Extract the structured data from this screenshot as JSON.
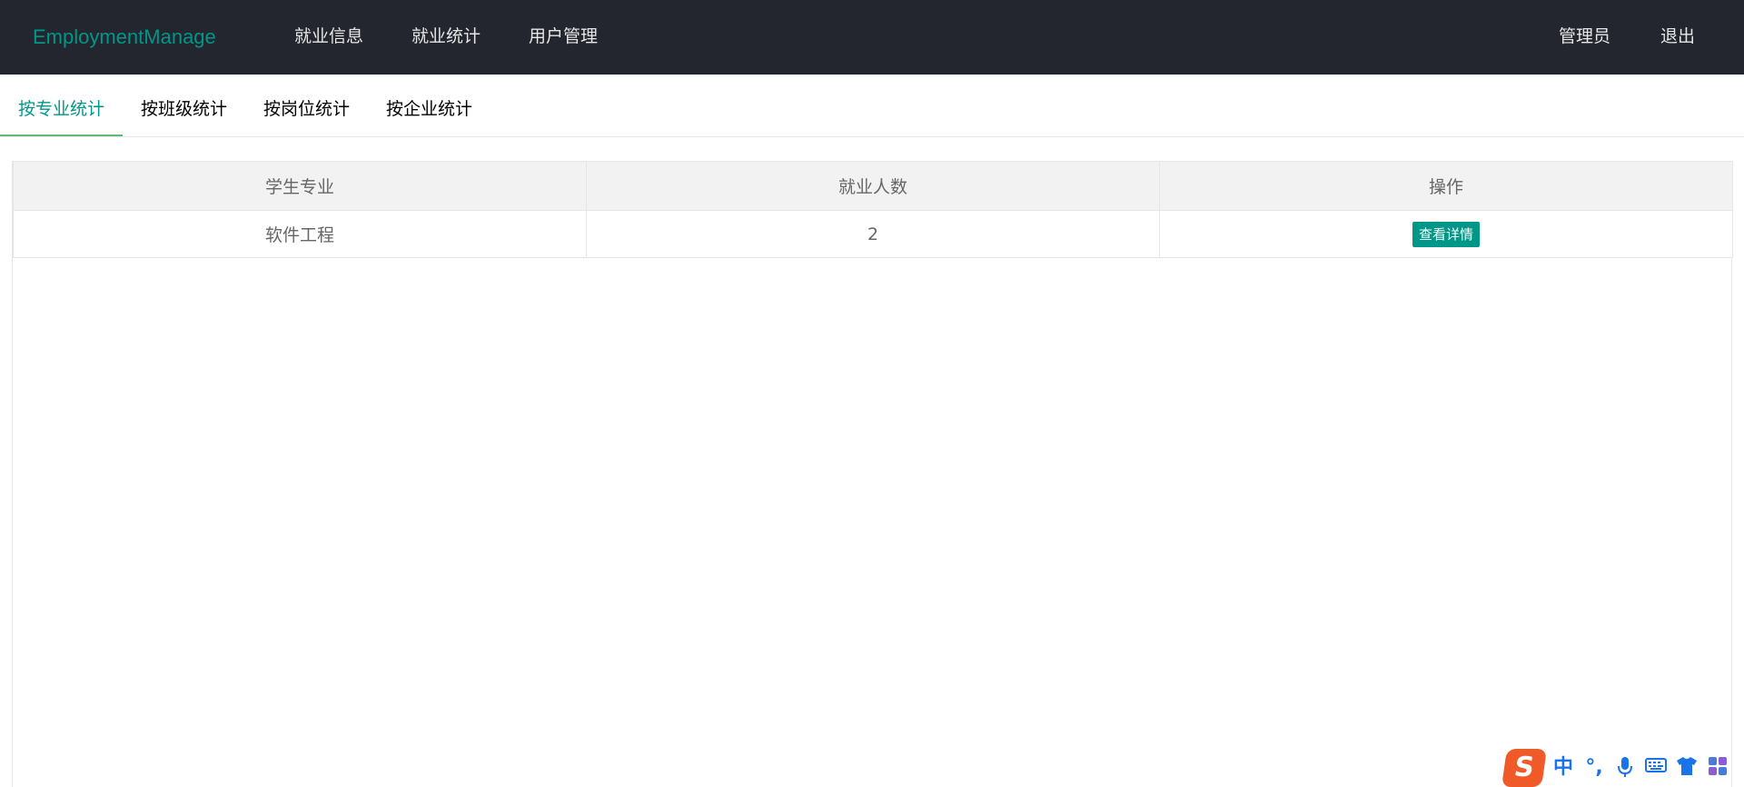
{
  "app": {
    "logo": "EmploymentManage"
  },
  "topnav": {
    "items": [
      {
        "label": "就业信息"
      },
      {
        "label": "就业统计"
      },
      {
        "label": "用户管理"
      }
    ],
    "right": {
      "user": "管理员",
      "logout": "退出"
    }
  },
  "tabs": [
    {
      "label": "按专业统计",
      "active": true
    },
    {
      "label": "按班级统计",
      "active": false
    },
    {
      "label": "按岗位统计",
      "active": false
    },
    {
      "label": "按企业统计",
      "active": false
    }
  ],
  "table": {
    "headers": [
      "学生专业",
      "就业人数",
      "操作"
    ],
    "rows": [
      {
        "major": "软件工程",
        "count": "2",
        "action": "查看详情"
      }
    ]
  },
  "ime": {
    "logo": "S",
    "mode": "中",
    "punct": "°,",
    "icons": [
      "sogou-logo-icon",
      "microphone-icon",
      "keyboard-icon",
      "shirt-icon",
      "grid-icon"
    ],
    "colors": {
      "logo": "#f05a28",
      "icon": "#1a73e8"
    }
  },
  "colors": {
    "accent": "#009688",
    "topbar": "#23262e",
    "tabUnderline": "#5fb878"
  }
}
